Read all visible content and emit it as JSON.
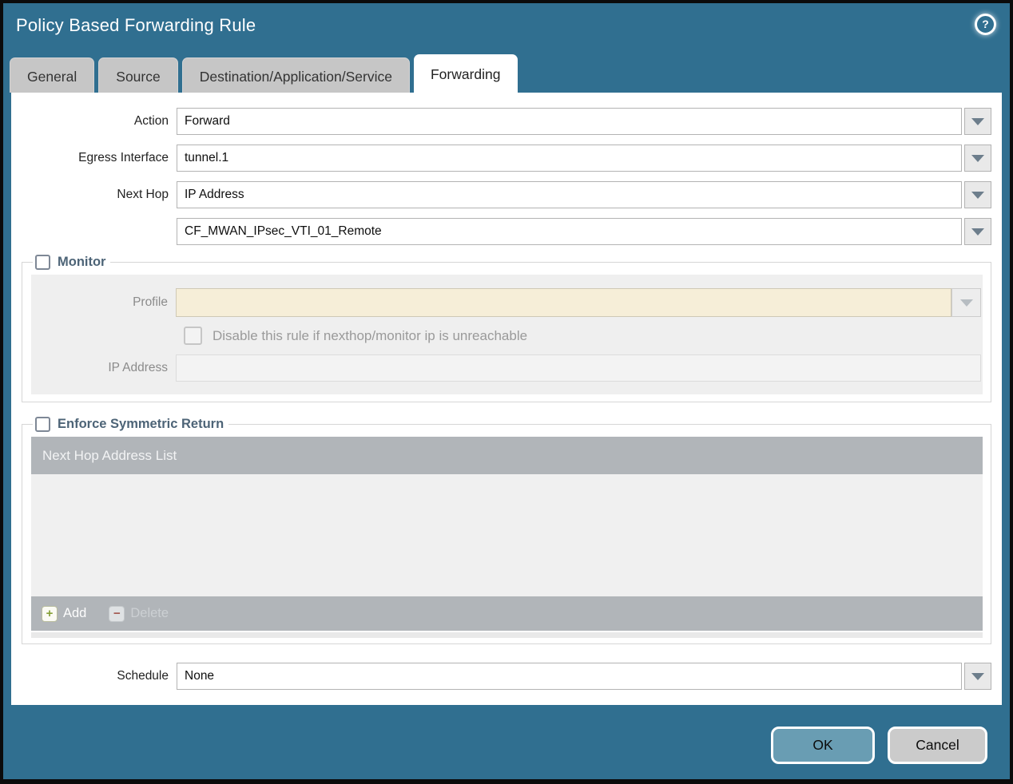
{
  "dialog": {
    "title": "Policy Based Forwarding Rule"
  },
  "help": {
    "glyph": "?"
  },
  "tabs": [
    {
      "label": "General",
      "active": false
    },
    {
      "label": "Source",
      "active": false
    },
    {
      "label": "Destination/Application/Service",
      "active": false
    },
    {
      "label": "Forwarding",
      "active": true
    }
  ],
  "form": {
    "action": {
      "label": "Action",
      "value": "Forward"
    },
    "egress_interface": {
      "label": "Egress Interface",
      "value": "tunnel.1"
    },
    "next_hop": {
      "label": "Next Hop",
      "value": "IP Address"
    },
    "next_hop_address": {
      "value": "CF_MWAN_IPsec_VTI_01_Remote"
    },
    "schedule": {
      "label": "Schedule",
      "value": "None"
    }
  },
  "monitor": {
    "legend": "Monitor",
    "checked": false,
    "profile": {
      "label": "Profile",
      "value": "",
      "disabled": true
    },
    "disable_rule": {
      "label": "Disable this rule if nexthop/monitor ip is unreachable",
      "checked": false,
      "disabled": true
    },
    "ip_address": {
      "label": "IP Address",
      "value": "",
      "disabled": true
    }
  },
  "symmetric_return": {
    "legend": "Enforce Symmetric Return",
    "checked": false,
    "list": {
      "header": "Next Hop Address List",
      "rows": []
    },
    "toolbar": {
      "add_label": "Add",
      "add_glyph": "+",
      "delete_label": "Delete",
      "delete_glyph": "−",
      "delete_disabled": true
    }
  },
  "footer": {
    "ok_label": "OK",
    "cancel_label": "Cancel"
  },
  "colors": {
    "titlebar_teal": "#306f90",
    "ok_button": "#699db3",
    "cancel_button": "#cbcbcb",
    "disabled_input_cream": "#f6eed8",
    "list_gray": "#b1b5b9",
    "legend_text": "#4d6477"
  }
}
